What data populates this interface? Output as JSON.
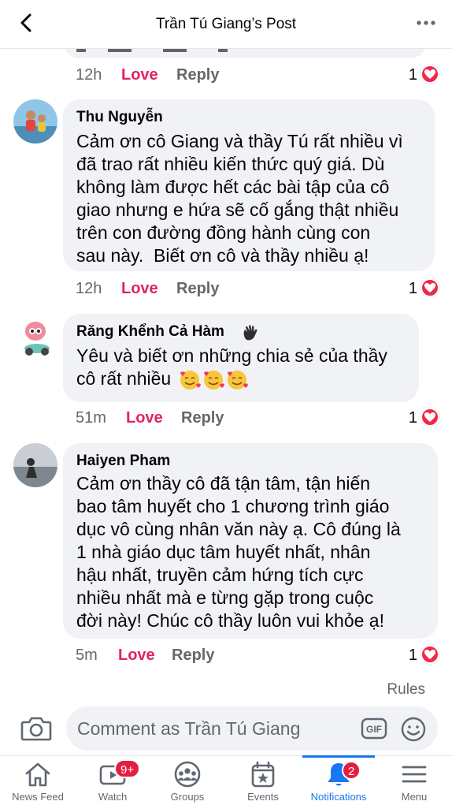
{
  "header": {
    "title": "Trần Tú Giang’s Post"
  },
  "comments": [
    {
      "time": "12h",
      "love": "Love",
      "reply": "Reply",
      "count": "1"
    },
    {
      "name": "Thu Nguyễn",
      "lines": [
        "Cảm ơn cô Giang và thầy Tú rất nhiều vì",
        "đã trao rất nhiều kiến thức quý giá. Dù",
        "không làm được hết các bài tập của cô",
        "giao nhưng e hứa sẽ cố gắng thật nhiều",
        "trên con đường đồng hành cùng con",
        "sau này.  Biết ơn cô và thầy nhiều ạ!"
      ],
      "time": "12h",
      "love": "Love",
      "reply": "Reply",
      "count": "1"
    },
    {
      "name": "Răng Khểnh Cả Hàm",
      "badge_icon": "waving-hand-emoji",
      "lines": [
        "Yêu và biết ơn những chia sẻ của thầy",
        "cô rất nhiều"
      ],
      "emoji": "smiling-face-with-hearts-emoji",
      "time": "51m",
      "love": "Love",
      "reply": "Reply",
      "count": "1"
    },
    {
      "name": "Haiyen Pham",
      "lines": [
        "Cảm ơn thầy cô đã tận tâm, tận hiến",
        "bao tâm huyết cho 1 chương trình giáo",
        "dục vô cùng nhân văn này ạ. Cô đúng là",
        "1 nhà giáo dục tâm huyết nhất, nhân",
        "hậu nhất, truyền cảm hứng tích cực",
        "nhiều nhất mà e từng gặp trong cuộc",
        "đời này! Chúc cô thầy luôn vui khỏe ạ!"
      ],
      "time": "5m",
      "love": "Love",
      "reply": "Reply",
      "count": "1"
    }
  ],
  "rules_label": "Rules",
  "composer": {
    "placeholder": "Comment as Trần Tú Giang",
    "gif_label": "GIF"
  },
  "tabs": [
    {
      "label": "News Feed",
      "icon": "home-icon"
    },
    {
      "label": "Watch",
      "icon": "watch-icon",
      "badge": "9+"
    },
    {
      "label": "Groups",
      "icon": "groups-icon"
    },
    {
      "label": "Events",
      "icon": "calendar-star-icon"
    },
    {
      "label": "Notifications",
      "icon": "bell-icon",
      "badge": "2",
      "active": true
    },
    {
      "label": "Menu",
      "icon": "menu-icon"
    }
  ],
  "colors": {
    "accent": "#1877f2",
    "love": "#e0245e",
    "badge": "#e41e3f",
    "bubble": "#f0f2f5"
  }
}
